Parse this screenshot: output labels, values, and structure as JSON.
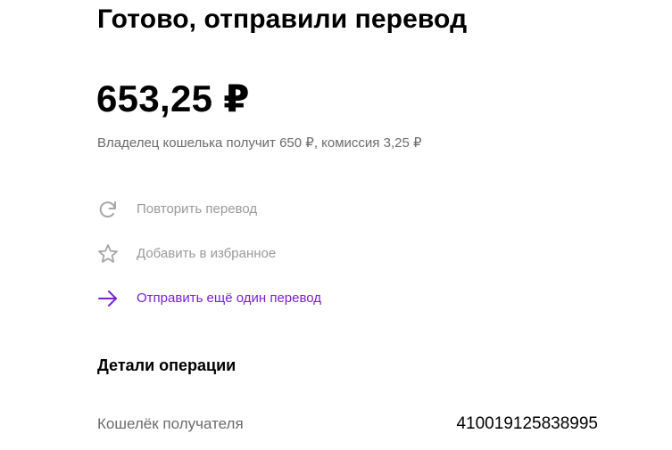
{
  "header": {
    "title": "Готово, отправили перевод"
  },
  "payment": {
    "amount": "653,25 ₽",
    "summary": "Владелец кошелька получит 650 ₽, комиссия 3,25 ₽"
  },
  "actions": [
    {
      "label": "Повторить перевод",
      "icon": "refresh-icon",
      "state": "disabled",
      "color": "#9a9a9a"
    },
    {
      "label": "Добавить в избранное",
      "icon": "star-icon",
      "state": "disabled",
      "color": "#9a9a9a"
    },
    {
      "label": "Отправить ещё один перевод",
      "icon": "arrow-right-icon",
      "state": "active",
      "color": "#7a1fd6"
    }
  ],
  "details": {
    "title": "Детали операции",
    "rows": [
      {
        "key": "Кошелёк получателя",
        "value": "410019125838995"
      }
    ]
  }
}
